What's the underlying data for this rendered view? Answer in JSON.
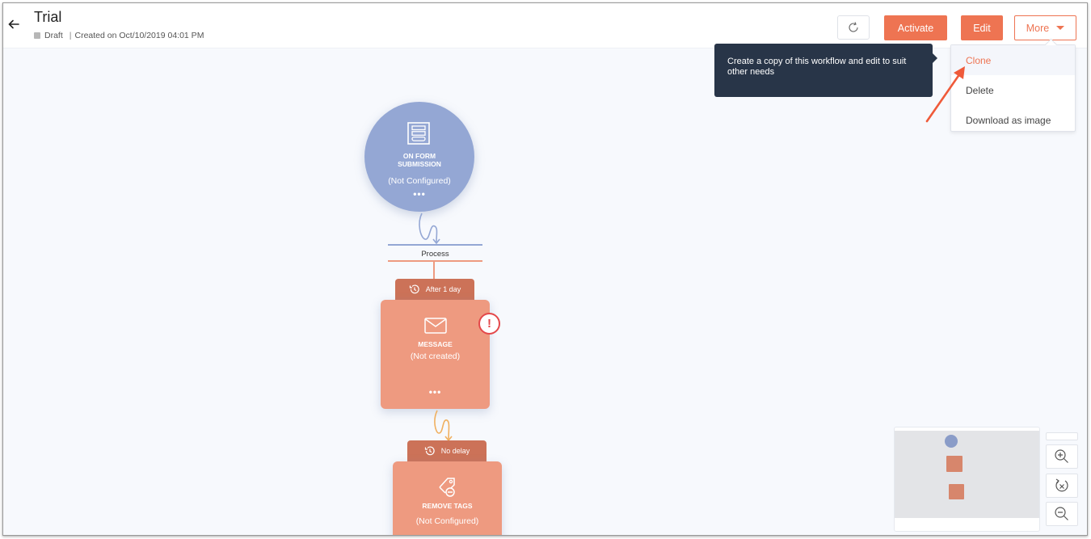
{
  "header": {
    "title": "Trial",
    "status": "Draft",
    "created": "Created on Oct/10/2019 04:01 PM",
    "separator": "|"
  },
  "toolbar": {
    "refresh_icon": "refresh-icon",
    "activate_label": "Activate",
    "edit_label": "Edit",
    "more_label": "More"
  },
  "more_menu": {
    "items": [
      {
        "label": "Clone",
        "active": true
      },
      {
        "label": "Delete",
        "active": false
      },
      {
        "label": "Download as image",
        "active": false
      }
    ]
  },
  "tooltip": {
    "text": "Create a copy of this workflow and edit to suit other needs"
  },
  "workflow": {
    "trigger": {
      "icon": "form-icon",
      "label": "ON FORM SUBMISSION",
      "status": "(Not Configured)",
      "more": "•••"
    },
    "process_label": "Process",
    "steps": [
      {
        "delay": "After 1 day",
        "icon": "envelope-icon",
        "label": "MESSAGE",
        "status": "(Not created)",
        "more": "•••",
        "warning": "!"
      },
      {
        "delay": "No delay",
        "icon": "remove-tag-icon",
        "label": "REMOVE TAGS",
        "status": "(Not Configured)"
      }
    ]
  },
  "colors": {
    "accent": "#ee7452",
    "trigger_node": "#94a7d4",
    "action_node": "#ee9a80",
    "delay_tab": "#cc7258",
    "tooltip_bg": "#283548",
    "warning": "#e4484a"
  }
}
